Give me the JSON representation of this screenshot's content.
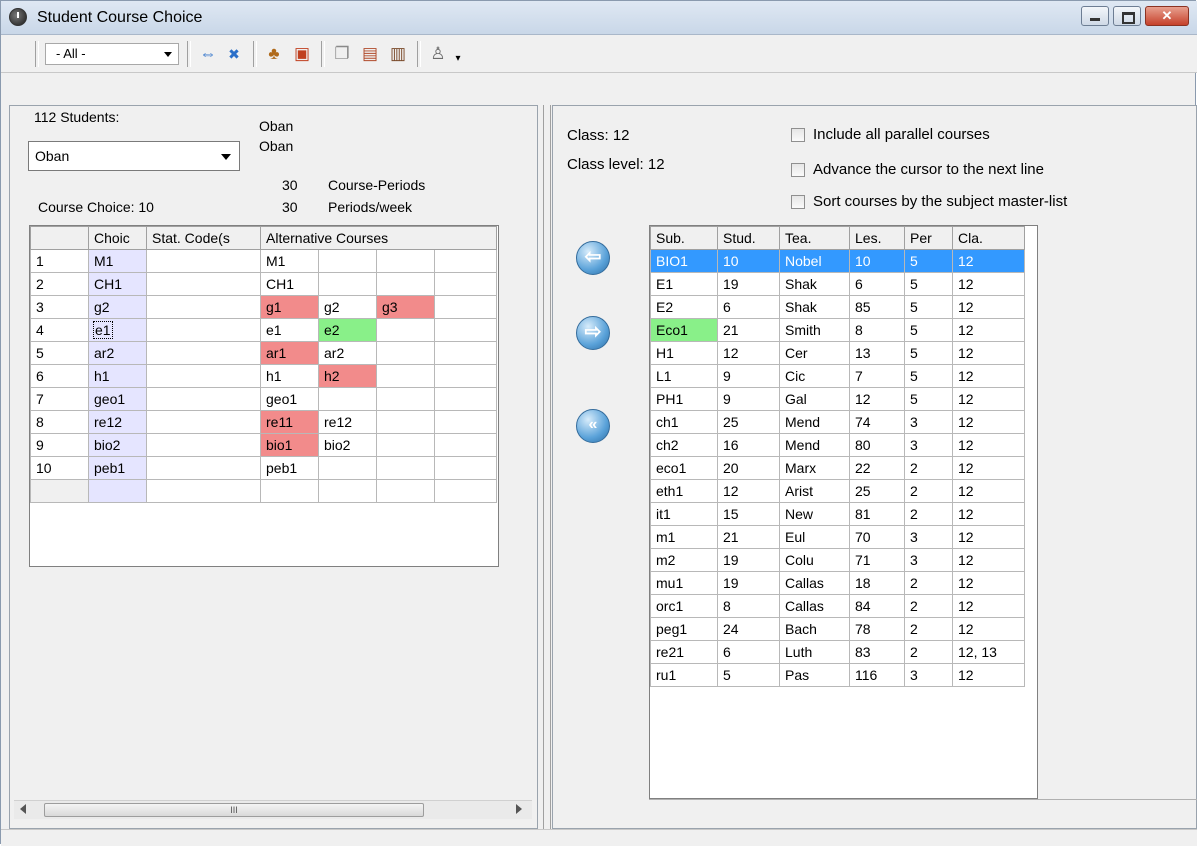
{
  "window": {
    "title": "Student Course Choice"
  },
  "toolbar": {
    "filter_value": "- All -"
  },
  "left": {
    "students_label": "112 Students:",
    "student_select": "Oban",
    "name_line1": "Oban",
    "name_line2": "Oban",
    "course_periods_value": "30",
    "course_periods_label": "Course-Periods",
    "periods_week_value": "30",
    "periods_week_label": "Periods/week",
    "course_choice_label": "Course Choice: 10",
    "columns": [
      "Choic",
      "Stat. Code(s",
      "Alternative Courses"
    ],
    "rows": [
      {
        "num": "1",
        "choice": "M1",
        "stat": "",
        "alts": [
          "M1",
          "",
          ""
        ],
        "alt_colors": [
          "",
          "",
          ""
        ]
      },
      {
        "num": "2",
        "choice": "CH1",
        "stat": "",
        "alts": [
          "CH1",
          "",
          ""
        ],
        "alt_colors": [
          "",
          "",
          ""
        ]
      },
      {
        "num": "3",
        "choice": "g2",
        "stat": "",
        "alts": [
          "g1",
          "g2",
          "g3"
        ],
        "alt_colors": [
          "red",
          "",
          "red"
        ]
      },
      {
        "num": "4",
        "choice": "e1",
        "stat": "",
        "alts": [
          "e1",
          "e2",
          ""
        ],
        "alt_colors": [
          "",
          "green",
          ""
        ]
      },
      {
        "num": "5",
        "choice": "ar2",
        "stat": "",
        "alts": [
          "ar1",
          "ar2",
          ""
        ],
        "alt_colors": [
          "red",
          "",
          ""
        ]
      },
      {
        "num": "6",
        "choice": "h1",
        "stat": "",
        "alts": [
          "h1",
          "h2",
          ""
        ],
        "alt_colors": [
          "",
          "red",
          ""
        ]
      },
      {
        "num": "7",
        "choice": "geo1",
        "stat": "",
        "alts": [
          "geo1",
          "",
          ""
        ],
        "alt_colors": [
          "",
          "",
          ""
        ]
      },
      {
        "num": "8",
        "choice": "re12",
        "stat": "",
        "alts": [
          "re11",
          "re12",
          ""
        ],
        "alt_colors": [
          "red",
          "",
          ""
        ]
      },
      {
        "num": "9",
        "choice": "bio2",
        "stat": "",
        "alts": [
          "bio1",
          "bio2",
          ""
        ],
        "alt_colors": [
          "red",
          "",
          ""
        ]
      },
      {
        "num": "10",
        "choice": "peb1",
        "stat": "",
        "alts": [
          "peb1",
          "",
          ""
        ],
        "alt_colors": [
          "",
          "",
          ""
        ]
      }
    ],
    "scroll_thumb_label": "III"
  },
  "right": {
    "class_label": "Class: 12",
    "class_level_label": "Class level: 12",
    "options": [
      {
        "label": "Include all parallel courses",
        "checked": false
      },
      {
        "label": "Advance the cursor to the next line",
        "checked": false
      },
      {
        "label": "Sort courses by the subject master-list",
        "checked": false
      }
    ],
    "columns": [
      "Sub.",
      "Stud.",
      "Tea.",
      "Les.",
      "Per",
      "Cla."
    ],
    "rows": [
      [
        "BIO1",
        "10",
        "Nobel",
        "10",
        "5",
        "12"
      ],
      [
        "E1",
        "19",
        "Shak",
        "6",
        "5",
        "12"
      ],
      [
        "E2",
        "6",
        "Shak",
        "85",
        "5",
        "12"
      ],
      [
        "Eco1",
        "21",
        "Smith",
        "8",
        "5",
        "12"
      ],
      [
        "H1",
        "12",
        "Cer",
        "13",
        "5",
        "12"
      ],
      [
        "L1",
        "9",
        "Cic",
        "7",
        "5",
        "12"
      ],
      [
        "PH1",
        "9",
        "Gal",
        "12",
        "5",
        "12"
      ],
      [
        "ch1",
        "25",
        "Mend",
        "74",
        "3",
        "12"
      ],
      [
        "ch2",
        "16",
        "Mend",
        "80",
        "3",
        "12"
      ],
      [
        "eco1",
        "20",
        "Marx",
        "22",
        "2",
        "12"
      ],
      [
        "eth1",
        "12",
        "Arist",
        "25",
        "2",
        "12"
      ],
      [
        "it1",
        "15",
        "New",
        "81",
        "2",
        "12"
      ],
      [
        "m1",
        "21",
        "Eul",
        "70",
        "3",
        "12"
      ],
      [
        "m2",
        "19",
        "Colu",
        "71",
        "3",
        "12"
      ],
      [
        "mu1",
        "19",
        "Callas",
        "18",
        "2",
        "12"
      ],
      [
        "orc1",
        "8",
        "Callas",
        "84",
        "2",
        "12"
      ],
      [
        "peg1",
        "24",
        "Bach",
        "78",
        "2",
        "12"
      ],
      [
        "re21",
        "6",
        "Luth",
        "83",
        "2",
        "12, 13"
      ],
      [
        "ru1",
        "5",
        "Pas",
        "116",
        "3",
        "12"
      ]
    ],
    "selected_row": 0,
    "green_row": 3
  },
  "colors": {
    "selection": "#3399ff",
    "red": "#f28b8b",
    "green": "#89f089",
    "choice_bg": "#e5e5ff"
  }
}
